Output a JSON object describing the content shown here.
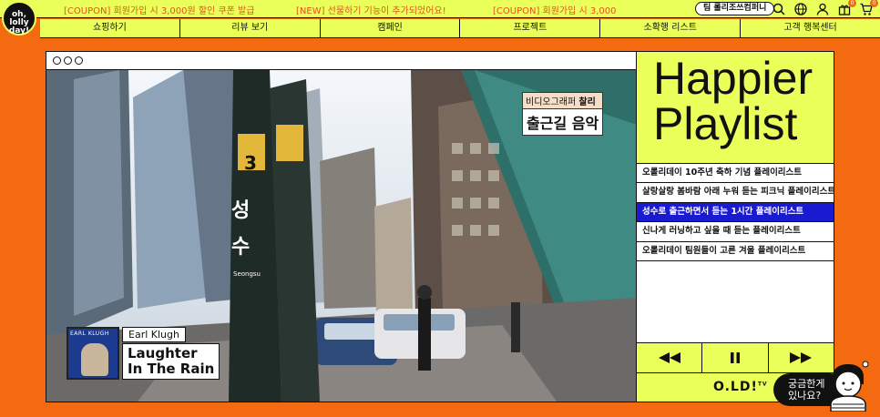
{
  "logo": {
    "text_line1": "oh,",
    "text_line2": "lolly",
    "text_line3": "day!"
  },
  "marquee": [
    "[COUPON] 회원가입 시 3,000원 할인 쿠폰 발급",
    "[NEW] 선물하기 기능이 추가되었어요!",
    "[COUPON] 회원가입 시 3,000"
  ],
  "header": {
    "team_button": "팀 롤리조쓰컴퍼니",
    "cart_count": "0",
    "wishlist_count": "0"
  },
  "nav": [
    "쇼핑하기",
    "리뷰 보기",
    "캠페인",
    "프로젝트",
    "소확행 리스트",
    "고객 행복센터"
  ],
  "video": {
    "caption_small_prefix": "비디오그래퍼 ",
    "caption_small_name": "찰리",
    "caption_big": "출근길 음악",
    "album_title": "EARL KLUGH",
    "artist": "Earl Klugh",
    "song_line1": "Laughter",
    "song_line2": "In The Rain",
    "sign_number": "3",
    "sign_text": "성 수",
    "sign_sub": "Seongsu"
  },
  "playlist": {
    "title_line1": "Happier",
    "title_line2": "Playlist",
    "items": [
      "오롤리데이 10주년 축하 기념 플레이리스트",
      "살랑살랑 봄바람 아래 누워 듣는 피크닉 플레이리스트",
      "성수로 출근하면서 듣는 1시간 플레이리스트",
      "신나게 러닝하고 싶을 때 듣는 플레이리스트",
      "오롤리데이 팀원들이 고른 겨울 플레이리스트"
    ],
    "active_index": 2,
    "brand": "O.LD!",
    "brand_sup": "TV"
  },
  "help": {
    "line1": "궁금한게",
    "line2": "있나요?"
  },
  "colors": {
    "background": "#f36a10",
    "accent": "#eaff5a",
    "active": "#1a1ad0",
    "ink": "#111111"
  }
}
